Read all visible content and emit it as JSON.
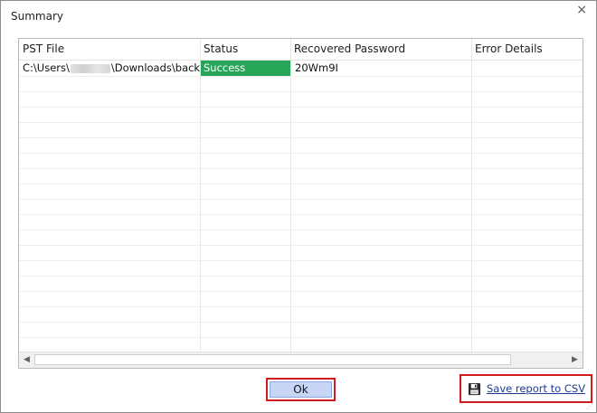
{
  "window": {
    "title": "Summary",
    "close_glyph": "×"
  },
  "table": {
    "columns": [
      "PST File",
      "Status",
      "Recovered Password",
      "Error Details"
    ],
    "rows": [
      {
        "pst_prefix": "C:\\Users\\",
        "pst_suffix": "\\Downloads\\backu...",
        "status": "Success",
        "password": "20Wm9I",
        "error": ""
      }
    ]
  },
  "buttons": {
    "ok": "Ok",
    "save_csv": "Save report to CSV"
  },
  "icons": {
    "save": "floppy-disk-icon",
    "close": "close-icon",
    "scroll_left": "◀",
    "scroll_right": "▶"
  },
  "colors": {
    "success": "#27a559",
    "highlight": "#d11a1a",
    "ok_button": "#c8d6f6",
    "link": "#1f3b9a"
  }
}
